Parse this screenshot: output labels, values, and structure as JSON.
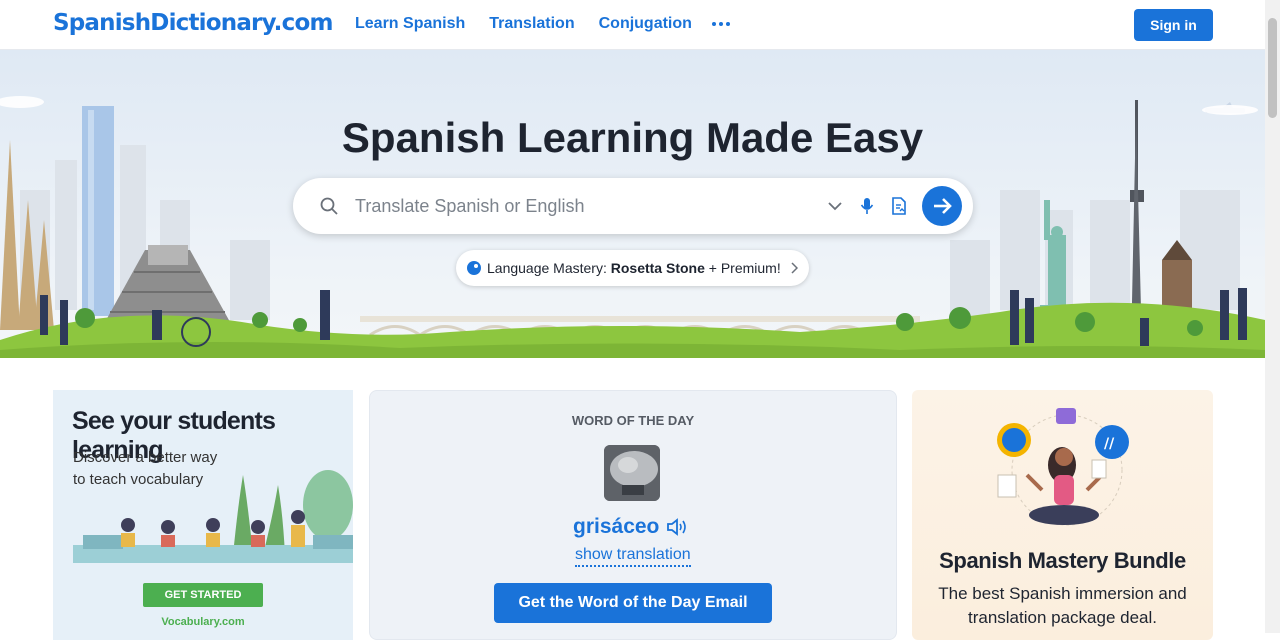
{
  "header": {
    "logo": "SpanishDictionary.com",
    "nav": [
      "Learn Spanish",
      "Translation",
      "Conjugation"
    ],
    "more_icon": "ellipsis-icon",
    "signin_label": "Sign in"
  },
  "hero": {
    "title": "Spanish Learning Made Easy",
    "search_placeholder": "Translate Spanish or English",
    "promo_prefix": "Language Mastery: ",
    "promo_brand": "Rosetta Stone",
    "promo_suffix": " + Premium!"
  },
  "ad": {
    "title": "See your students learning",
    "subtitle": "Discover a better way to teach vocabulary",
    "button": "GET STARTED",
    "domain": "Vocabulary.com"
  },
  "wotd": {
    "label": "WORD OF THE DAY",
    "word": "grisáceo",
    "show_translation": "show translation",
    "email_button": "Get the Word of the Day Email"
  },
  "bundle": {
    "title": "Spanish Mastery Bundle",
    "subtitle": "The best Spanish immersion and translation package deal."
  },
  "colors": {
    "brand": "#1a73d9",
    "text": "#1e2430",
    "grass": "#8dc63f"
  }
}
